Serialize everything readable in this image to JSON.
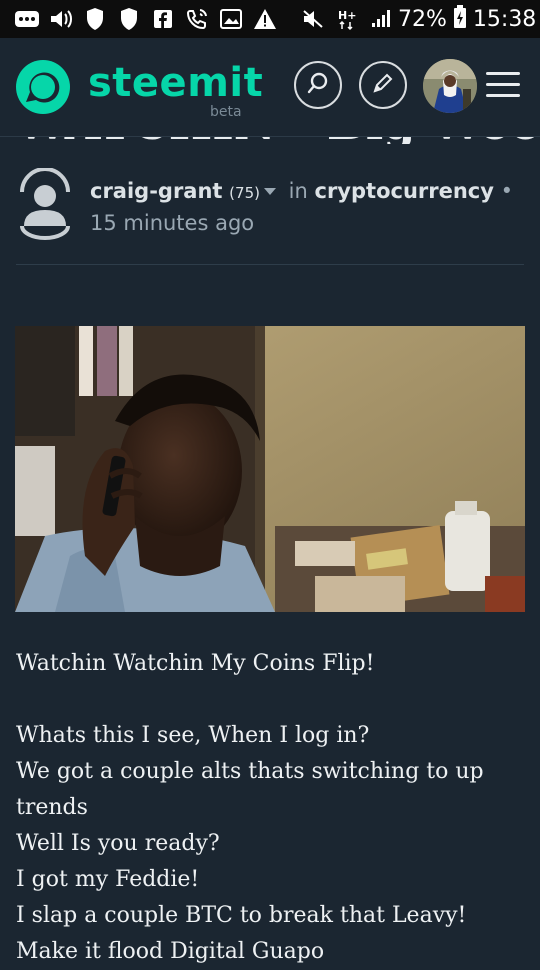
{
  "status_bar": {
    "battery": "72%",
    "time": "15:38",
    "icons": [
      "more-icon",
      "volume-icon",
      "shield-icon",
      "shield-icon",
      "facebook-icon",
      "wifi-calling-icon",
      "image-icon",
      "warning-icon",
      "mute-icon",
      "hplus-icon",
      "signal-icon",
      "battery-icon"
    ]
  },
  "header": {
    "brand": "steemit",
    "brand_sub": "beta",
    "accent": "#06d6a9",
    "buttons": [
      "search-icon",
      "edit-icon",
      "avatar",
      "menu-icon"
    ]
  },
  "post": {
    "title": "WATCHIN - Big Wood",
    "author": "craig-grant",
    "reputation": "(75)",
    "in_label": "in",
    "category": "cryptocurrency",
    "separator": "•",
    "time_ago": "15 minutes ago",
    "image_alt": "Man on phone looking down",
    "body_lines": [
      "Watchin Watchin My Coins Flip!",
      "",
      "Whats this I see, When I log in?",
      "We got a couple alts thats switching to up trends",
      "Well Is you ready?",
      "I got my Feddie!",
      "I slap a couple BTC to break that Leavy!",
      "Make it flood Digital Guapo"
    ]
  },
  "colors": {
    "background": "#1b2631",
    "status_bar": "#0d0d0d",
    "text": "#e8ecef",
    "muted": "#9aa8b3"
  }
}
